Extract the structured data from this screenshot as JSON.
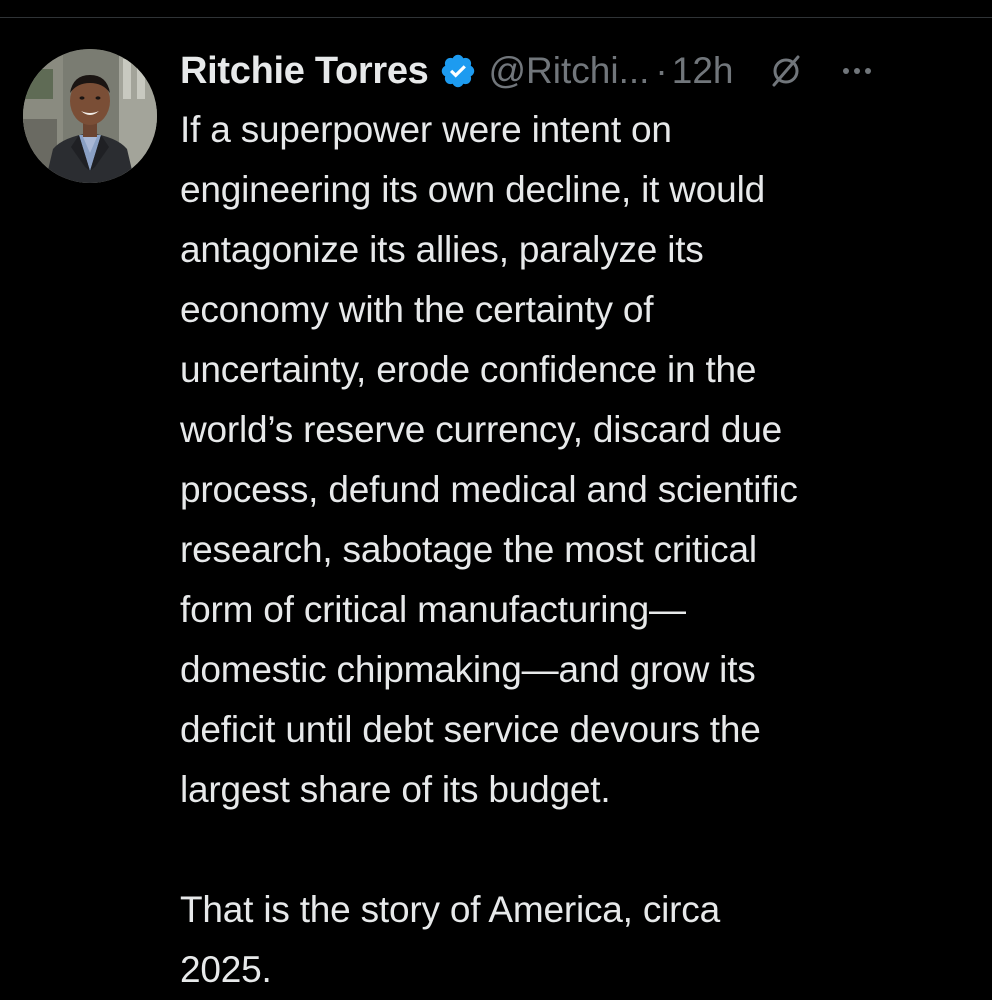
{
  "author": {
    "display_name": "Ritchie Torres",
    "handle": "@Ritchi...",
    "separator": "·",
    "time": "12h",
    "verified": true,
    "verified_color": "#1d9bf0"
  },
  "icons": {
    "verified": "verified-badge-icon",
    "grok": "grok-icon",
    "more": "more-options-icon"
  },
  "tweet": {
    "paragraph_1": [
      "If a superpower were intent on",
      "engineering its own decline, it would",
      "antagonize its allies, paralyze its",
      "economy with the certainty of",
      "uncertainty, erode confidence in the",
      "world’s reserve currency, discard due",
      "process, defund medical and scientific",
      "research, sabotage the most critical",
      "form of critical manufacturing—",
      "domestic chipmaking—and grow its",
      "deficit until debt service devours the",
      "largest share of its budget."
    ],
    "paragraph_2": [
      "That is the story of America, circa",
      "2025."
    ]
  },
  "colors": {
    "background": "#000000",
    "text": "#e7e9ea",
    "muted": "#71767b",
    "divider": "#2f3336"
  }
}
